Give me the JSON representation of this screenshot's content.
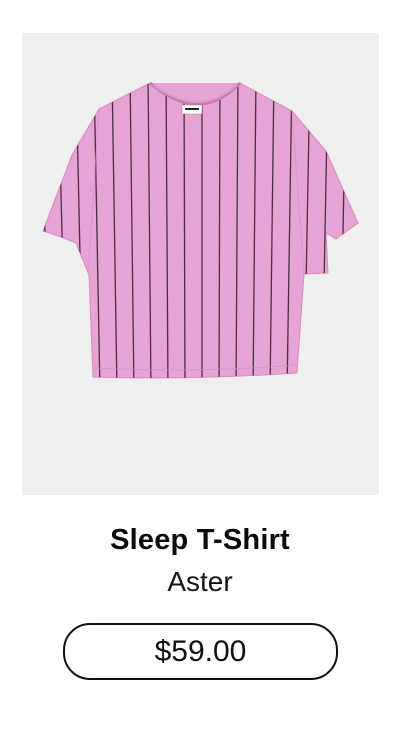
{
  "product": {
    "title": "Sleep T-Shirt",
    "brand": "Aster",
    "price": "$59.00",
    "image": {
      "icon": "tshirt-image",
      "shirt_color": "#e7a3d3",
      "stripe_color": "#3a2233",
      "background_color": "#efefef"
    }
  }
}
